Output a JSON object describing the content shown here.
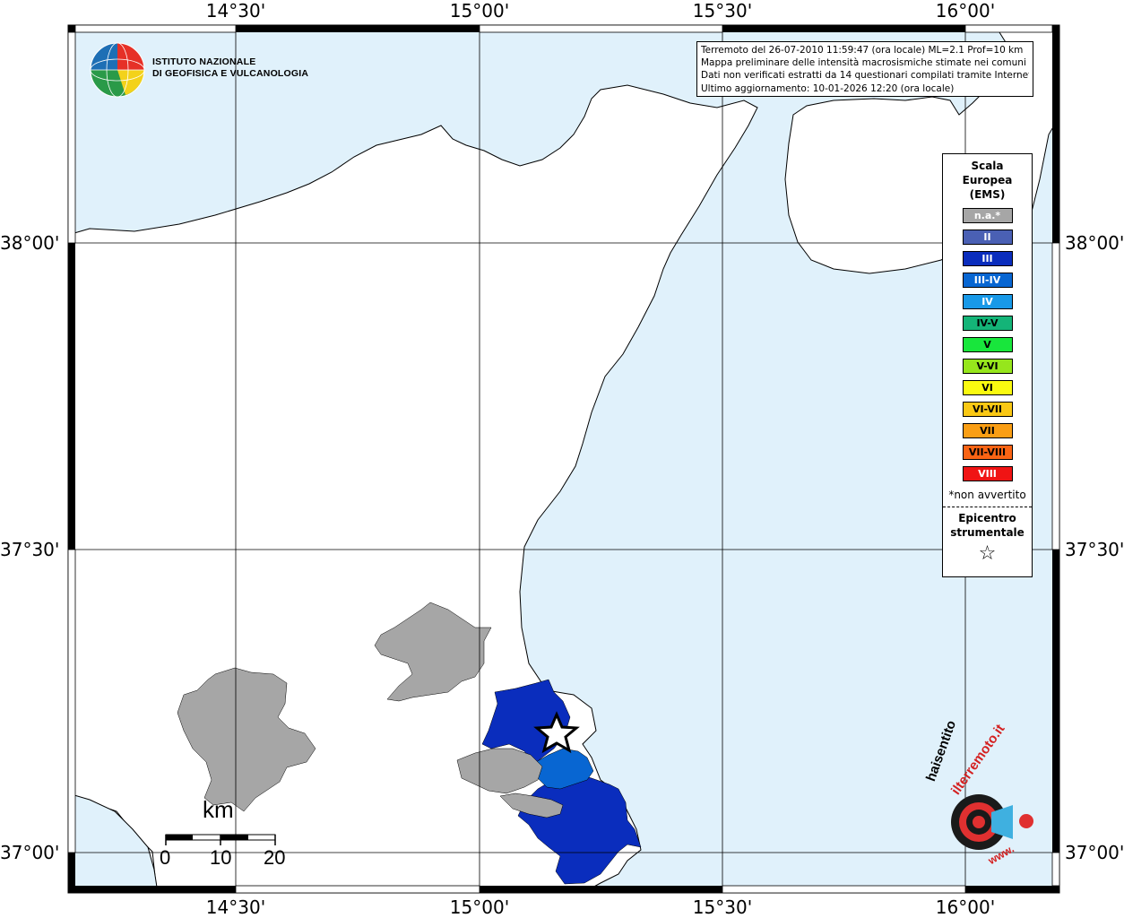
{
  "ticks": {
    "top": [
      "14°30'",
      "15°00'",
      "15°30'",
      "16°00'"
    ],
    "bottom": [
      "14°30'",
      "15°00'",
      "15°30'",
      "16°00'"
    ],
    "left": [
      "38°00'",
      "37°30'",
      "37°00'"
    ],
    "right": [
      "38°00'",
      "37°30'",
      "37°00'"
    ]
  },
  "info": {
    "line1": "Terremoto del 26-07-2010 11:59:47 (ora locale) ML=2.1 Prof=10 km",
    "line2": "Mappa preliminare delle intensità macrosismiche stimate nei comuni",
    "line3": "Dati non verificati estratti da 14 questionari compilati tramite Internet.",
    "line4": "Ultimo aggiornamento: 10-01-2026 12:20 (ora locale)"
  },
  "logo": {
    "line1": "ISTITUTO NAZIONALE",
    "line2": "DI GEOFISICA E VULCANOLOGIA"
  },
  "legend": {
    "title1": "Scala",
    "title2": "Europea",
    "title3": "(EMS)",
    "items": [
      {
        "label": "n.a.*",
        "color": "#a6a6a6"
      },
      {
        "label": "II",
        "color": "#4a60b4"
      },
      {
        "label": "III",
        "color": "#0a2dbd"
      },
      {
        "label": "III-IV",
        "color": "#0866d2"
      },
      {
        "label": "IV",
        "color": "#1899e8"
      },
      {
        "label": "IV-V",
        "color": "#14b478"
      },
      {
        "label": "V",
        "color": "#18e63c"
      },
      {
        "label": "V-VI",
        "color": "#96e61c"
      },
      {
        "label": "VI",
        "color": "#fafa10"
      },
      {
        "label": "VI-VII",
        "color": "#fac814"
      },
      {
        "label": "VII",
        "color": "#fa9e14"
      },
      {
        "label": "VII-VIII",
        "color": "#fa6414"
      },
      {
        "label": "VIII",
        "color": "#f01414"
      }
    ],
    "note": "*non avvertito",
    "epicentro1": "Epicentro",
    "epicentro2": "strumentale",
    "star": "☆"
  },
  "scale": {
    "unit": "km",
    "labels": [
      "0",
      "10",
      "20"
    ]
  },
  "watermark": {
    "text1": "haisentito",
    "text2": "ilterremoto.it",
    "text3": "www."
  },
  "colors": {
    "sea": "#e0f1fb",
    "land": "#ffffff",
    "gray": "#a6a6a6",
    "ems_III": "#0a2dbd",
    "ems_III_IV": "#0866d2"
  }
}
